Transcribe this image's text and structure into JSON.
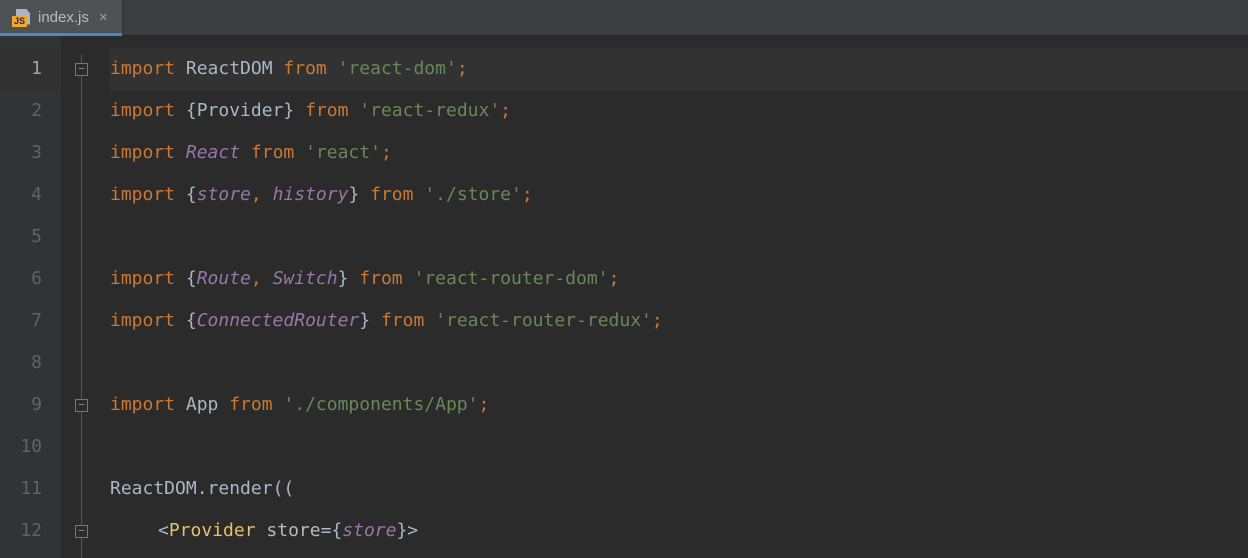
{
  "tab": {
    "filename": "index.js",
    "icon_badge": "JS"
  },
  "gutter": {
    "lines": [
      "1",
      "2",
      "3",
      "4",
      "5",
      "6",
      "7",
      "8",
      "9",
      "10",
      "11",
      "12"
    ],
    "active_line": 1
  },
  "code": {
    "lines": [
      {
        "n": 1,
        "t": [
          [
            "kw",
            "import "
          ],
          [
            "ident",
            "ReactDOM "
          ],
          [
            "kw",
            "from "
          ],
          [
            "str",
            "'react-dom'"
          ],
          [
            "punc",
            ";"
          ]
        ]
      },
      {
        "n": 2,
        "t": [
          [
            "kw",
            "import "
          ],
          [
            "default",
            "{"
          ],
          [
            "ident",
            "Provider"
          ],
          [
            "default",
            "} "
          ],
          [
            "kw",
            "from "
          ],
          [
            "str",
            "'react-redux'"
          ],
          [
            "punc",
            ";"
          ]
        ]
      },
      {
        "n": 3,
        "t": [
          [
            "kw",
            "import "
          ],
          [
            "ital",
            "React "
          ],
          [
            "kw",
            "from "
          ],
          [
            "str",
            "'react'"
          ],
          [
            "punc",
            ";"
          ]
        ]
      },
      {
        "n": 4,
        "t": [
          [
            "kw",
            "import "
          ],
          [
            "default",
            "{"
          ],
          [
            "ital",
            "store"
          ],
          [
            "punc",
            ", "
          ],
          [
            "ital",
            "history"
          ],
          [
            "default",
            "} "
          ],
          [
            "kw",
            "from "
          ],
          [
            "str",
            "'./store'"
          ],
          [
            "punc",
            ";"
          ]
        ]
      },
      {
        "n": 5,
        "t": []
      },
      {
        "n": 6,
        "t": [
          [
            "kw",
            "import "
          ],
          [
            "default",
            "{"
          ],
          [
            "ital",
            "Route"
          ],
          [
            "punc",
            ", "
          ],
          [
            "ital",
            "Switch"
          ],
          [
            "default",
            "} "
          ],
          [
            "kw",
            "from "
          ],
          [
            "str",
            "'react-router-dom'"
          ],
          [
            "punc",
            ";"
          ]
        ]
      },
      {
        "n": 7,
        "t": [
          [
            "kw",
            "import "
          ],
          [
            "default",
            "{"
          ],
          [
            "ital",
            "ConnectedRouter"
          ],
          [
            "default",
            "} "
          ],
          [
            "kw",
            "from "
          ],
          [
            "str",
            "'react-router-redux'"
          ],
          [
            "punc",
            ";"
          ]
        ]
      },
      {
        "n": 8,
        "t": []
      },
      {
        "n": 9,
        "t": [
          [
            "kw",
            "import "
          ],
          [
            "ident",
            "App "
          ],
          [
            "kw",
            "from "
          ],
          [
            "str",
            "'./components/App'"
          ],
          [
            "punc",
            ";"
          ]
        ]
      },
      {
        "n": 10,
        "t": []
      },
      {
        "n": 11,
        "t": [
          [
            "ident",
            "ReactDOM"
          ],
          [
            "default",
            "."
          ],
          [
            "ident",
            "render"
          ],
          [
            "default",
            "(("
          ]
        ]
      },
      {
        "n": 12,
        "indent": "indent1",
        "t": [
          [
            "default",
            "<"
          ],
          [
            "tag",
            "Provider "
          ],
          [
            "attr",
            "store"
          ],
          [
            "default",
            "="
          ],
          [
            "default",
            "{"
          ],
          [
            "ital",
            "store"
          ],
          [
            "default",
            "}>"
          ]
        ]
      }
    ]
  },
  "fold": {
    "marks": [
      {
        "line": 1,
        "type": "open"
      },
      {
        "line": 9,
        "type": "open"
      },
      {
        "line": 12,
        "type": "open"
      }
    ]
  }
}
